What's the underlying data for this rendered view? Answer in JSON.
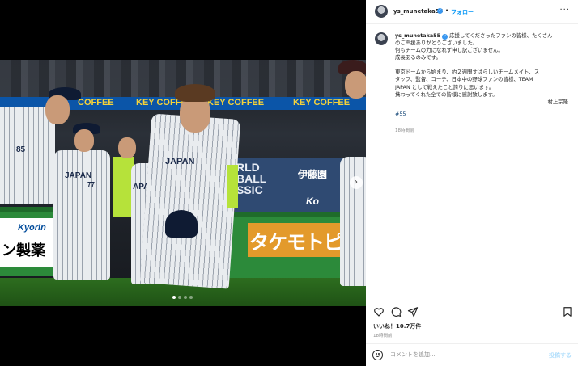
{
  "media": {
    "banner_top": [
      "COFFEE",
      "KEY COFFEE",
      "KEY COFFEE",
      "KEY COFFEE"
    ],
    "board_text": [
      "RLD",
      "BALL",
      "SSIC"
    ],
    "board_logo": "伊藤園",
    "board_logo2": "Ko",
    "kyorin_brand": "Kyorin",
    "kyorin_sub": "ン製薬",
    "takemoto_text": "タケモトピア",
    "jersey_text_a": "JAPAN",
    "jersey_text_b": "JAPAN",
    "jersey_text_c": "APAN",
    "jersey_number": "85",
    "jersey_number2": "77",
    "carousel_dots": 4,
    "carousel_active": 1
  },
  "header": {
    "username": "ys_munetaka55",
    "separator": "•",
    "follow_label": "フォロー",
    "more_label": "···"
  },
  "caption": {
    "username": "ys_munetaka55",
    "lines": [
      "応援してくださったファンの皆様、たくさん",
      "のご声援ありがとうございました。",
      "何もチームの力になれず申し訳ございません。",
      "成長あるのみです。",
      "",
      "東京ドームから始まり、約２週間すばらしいチームメイト、ス",
      "タッフ、監督、コーチ、日本中の野球ファンの皆様、TEAM",
      "JAPAN として戦えたこと誇りに思います。",
      "携わってくれた全ての皆様に感謝致します。"
    ],
    "signature": "村上宗隆",
    "hashtag": "#55",
    "time": "18時間前"
  },
  "actions": {
    "likes": "いいね！10.7万件",
    "time": "18時間前"
  },
  "comment_box": {
    "placeholder": "コメントを追加...",
    "post_label": "投稿する"
  },
  "colors": {
    "link": "#0095f6",
    "hashtag": "#00376b",
    "verified": "#3897f0",
    "muted": "#8e8e8e"
  }
}
